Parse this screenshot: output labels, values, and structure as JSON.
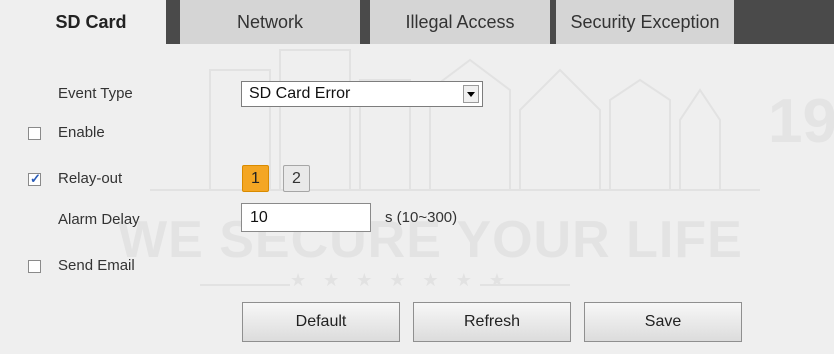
{
  "tabs": [
    {
      "label": "SD Card",
      "active": true
    },
    {
      "label": "Network",
      "active": false
    },
    {
      "label": "Illegal Access",
      "active": false
    },
    {
      "label": "Security Exception",
      "active": false
    }
  ],
  "form": {
    "event_type": {
      "label": "Event Type",
      "value": "SD Card Error"
    },
    "enable": {
      "label": "Enable",
      "checked": false
    },
    "relay_out": {
      "label": "Relay-out",
      "checked": true,
      "channels": [
        "1",
        "2"
      ],
      "selected": "1"
    },
    "alarm_delay": {
      "label": "Alarm Delay",
      "value": "10",
      "unit": "s (10~300)"
    },
    "send_email": {
      "label": "Send Email",
      "checked": false
    }
  },
  "buttons": {
    "default": "Default",
    "refresh": "Refresh",
    "save": "Save"
  },
  "watermark": {
    "text": "WE SECURE YOUR LIFE",
    "stars": "★ ★ ★ ★ ★ ★ ★",
    "number": "19"
  },
  "colors": {
    "background": "#efefef",
    "tab_bar": "#4a4a4a",
    "relay_selected": "#f4a623"
  }
}
